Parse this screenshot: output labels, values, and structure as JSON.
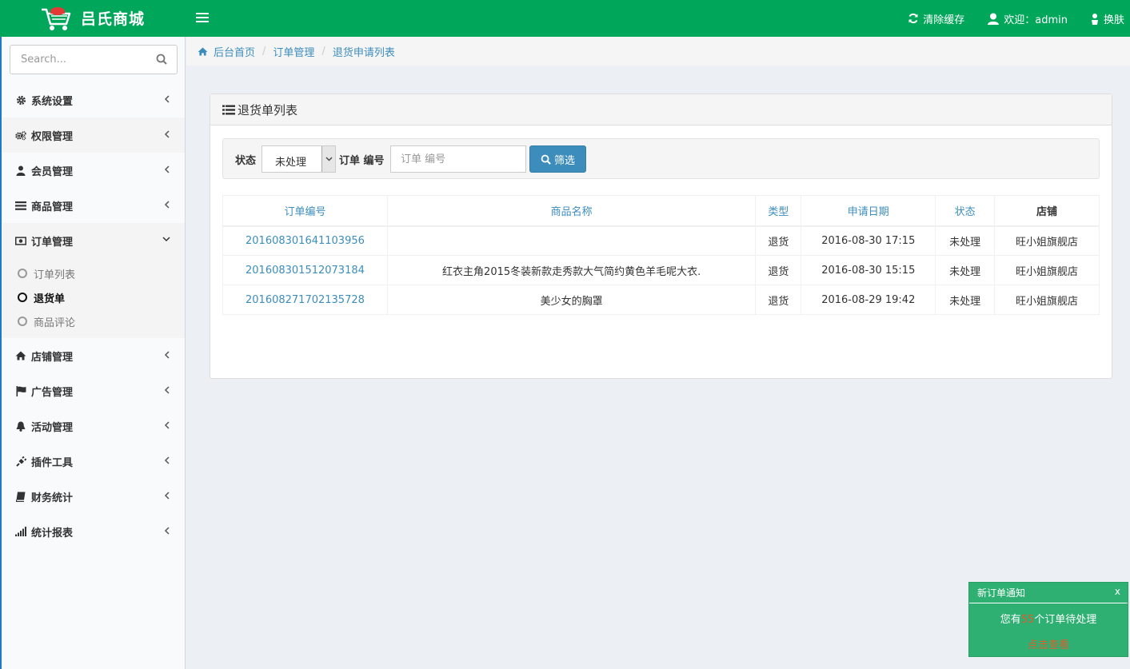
{
  "app": {
    "brand_name": "吕氏商城",
    "brand_color": "#00a65a",
    "accent_color": "#3c8dbc"
  },
  "topbar": {
    "clear_cache": "清除缓存",
    "welcome": "欢迎：admin",
    "skin": "换肤"
  },
  "sidebar": {
    "search_placeholder": "Search...",
    "items": [
      {
        "label": "系统设置",
        "icon": "gear-icon"
      },
      {
        "label": "权限管理",
        "icon": "gears-icon"
      },
      {
        "label": "会员管理",
        "icon": "user-icon"
      },
      {
        "label": "商品管理",
        "icon": "list-icon"
      },
      {
        "label": "订单管理",
        "icon": "money-icon"
      },
      {
        "label": "店铺管理",
        "icon": "home-icon"
      },
      {
        "label": "广告管理",
        "icon": "flag-icon"
      },
      {
        "label": "活动管理",
        "icon": "bell-icon"
      },
      {
        "label": "插件工具",
        "icon": "plug-icon"
      },
      {
        "label": "财务统计",
        "icon": "book-icon"
      },
      {
        "label": "统计报表",
        "icon": "signal-icon"
      }
    ],
    "order_submenu": [
      {
        "label": "订单列表"
      },
      {
        "label": "退货单"
      },
      {
        "label": "商品评论"
      }
    ]
  },
  "breadcrumb": {
    "home": "后台首页",
    "level1": "订单管理",
    "level2": "退货申请列表",
    "separator": "/"
  },
  "panel": {
    "title": "退货单列表",
    "filter": {
      "status_label": "状态",
      "status_value": "未处理",
      "order_label": "订单 编号",
      "order_placeholder": "订单 编号",
      "button": "筛选"
    },
    "table": {
      "headers": [
        "订单编号",
        "商品名称",
        "类型",
        "申请日期",
        "状态",
        "店铺"
      ],
      "rows": [
        {
          "order_no": "201608301641103956",
          "product": "",
          "type": "退货",
          "date": "2016-08-30 17:15",
          "status": "未处理",
          "shop": "旺小姐旗舰店"
        },
        {
          "order_no": "201608301512073184",
          "product": "红衣主角2015冬装新款走秀款大气简约黄色羊毛呢大衣.",
          "type": "退货",
          "date": "2016-08-30 15:15",
          "status": "未处理",
          "shop": "旺小姐旗舰店"
        },
        {
          "order_no": "201608271702135728",
          "product": "美少女的胸罩",
          "type": "退货",
          "date": "2016-08-29 19:42",
          "status": "未处理",
          "shop": "旺小姐旗舰店"
        }
      ]
    }
  },
  "notice": {
    "title": "新订单通知",
    "close": "x",
    "text_before": "您有",
    "count": "55",
    "text_after": "个订单待处理",
    "link": "点击查看"
  }
}
